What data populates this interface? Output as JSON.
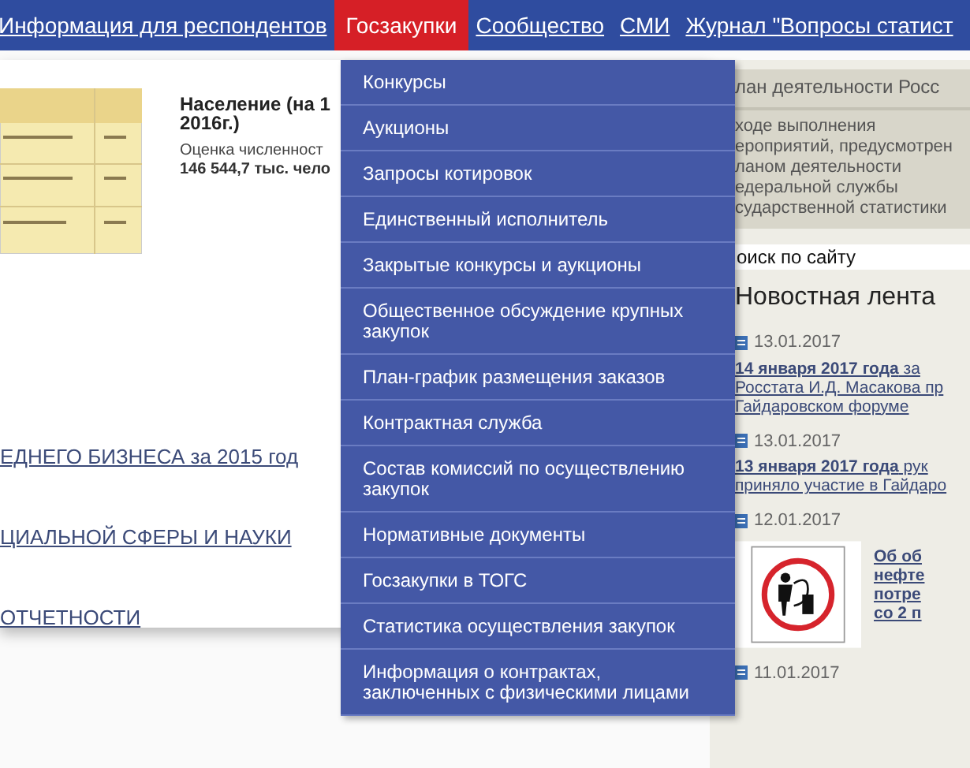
{
  "nav": [
    {
      "label": "Информация для респондентов",
      "selected": false
    },
    {
      "label": "Госзакупки",
      "selected": true
    },
    {
      "label": "Сообщество",
      "selected": false
    },
    {
      "label": "СМИ",
      "selected": false
    },
    {
      "label": "Журнал \"Вопросы статист",
      "selected": false
    }
  ],
  "dropdown": [
    "Конкурсы",
    "Аукционы",
    "Запросы котировок",
    "Единственный исполнитель",
    "Закрытые конкурсы и аукционы",
    "Общественное обсуждение крупных закупок",
    "План-график размещения заказов",
    "Контрактная служба",
    "Состав комиссий по осуществлению закупок",
    "Нормативные документы",
    "Госзакупки в ТОГС",
    "Статистика осуществления закупок",
    "Информация о контрактах, заключенных с физическими лицами"
  ],
  "population": {
    "heading_lines": [
      "Население (на 1",
      "2016г.)"
    ],
    "caption": "Оценка численност",
    "value": "146 544,7 тыс. чело"
  },
  "links": [
    "ЕДНЕГО БИЗНЕСА за 2015 год",
    "ЦИАЛЬНОЙ СФЕРЫ И НАУКИ",
    "ОТЧЕТНОСТИ"
  ],
  "plan": {
    "title": "лан деятельности Росс",
    "text_lines": [
      "ходе выполнения",
      "ероприятий, предусмотрен",
      "ланом деятельности",
      "едеральной службы",
      "сударственной статистики"
    ]
  },
  "search": {
    "placeholder": "оиск по сайту"
  },
  "news_title": "Новостная лента",
  "news": [
    {
      "kind": "text",
      "date": "13.01.2017",
      "link_lines": [
        "**14 января 2017 года**  за",
        "Росстата И.Д. Масакова пр",
        "Гайдаровском форуме"
      ]
    },
    {
      "kind": "text",
      "date": "13.01.2017",
      "link_lines": [
        "**13 января 2017 года**  рук",
        "приняло участие в Гайдаро"
      ]
    },
    {
      "kind": "image",
      "date": "12.01.2017",
      "link_lines": [
        "Об об",
        "нефте",
        "потре",
        "со 2 п"
      ]
    },
    {
      "kind": "text",
      "date": "11.01.2017"
    }
  ]
}
